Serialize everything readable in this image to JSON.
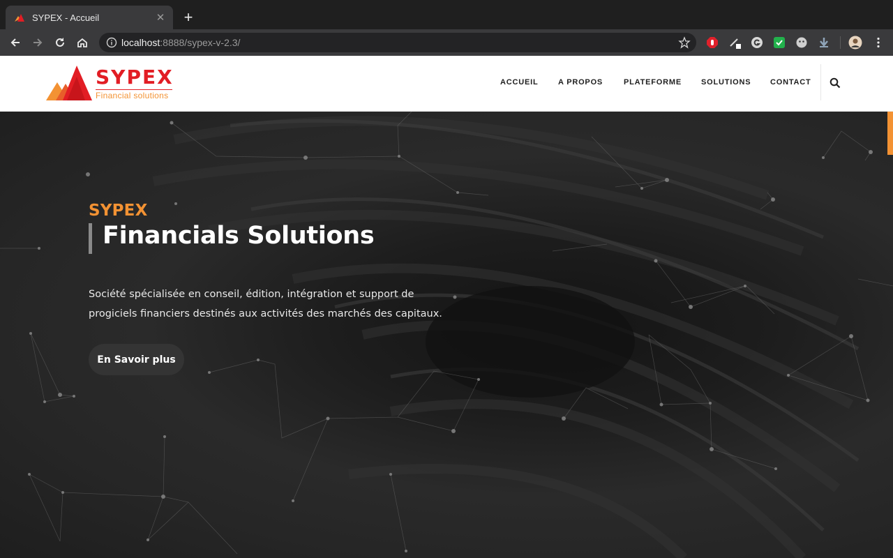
{
  "browser": {
    "tab": {
      "title": "SYPEX - Accueil",
      "close": "✕"
    },
    "new_tab": "+",
    "url": {
      "host": "localhost",
      "rest": ":8888/sypex-v-2.3/"
    }
  },
  "site": {
    "logo": {
      "name": "SYPEX",
      "tagline": "Financial solutions"
    },
    "nav": [
      "ACCUEIL",
      "A PROPOS",
      "PLATEFORME",
      "SOLUTIONS",
      "CONTACT"
    ],
    "hero": {
      "eyebrow": "SYPEX",
      "title": "Financials Solutions",
      "description_line1": "Société spécialisée en conseil, édition, intégration et support de",
      "description_line2": "progiciels financiers destinés aux activités des marchés des capitaux.",
      "button": "En Savoir plus"
    }
  },
  "colors": {
    "brand_red": "#e21d24",
    "brand_orange": "#f39233",
    "hero_bg": "#1e1e1e"
  },
  "icons": [
    "back-icon",
    "forward-icon",
    "reload-icon",
    "home-icon",
    "info-icon",
    "star-icon",
    "search-icon"
  ]
}
